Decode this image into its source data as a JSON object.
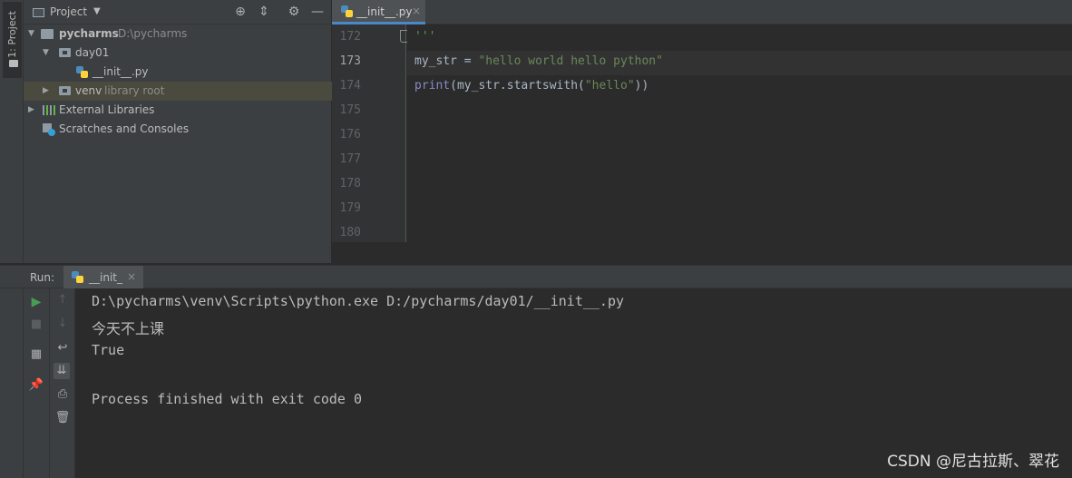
{
  "tool_strip": {
    "project_tab": "1: Project"
  },
  "project_pane": {
    "title": "Project",
    "tree": [
      {
        "label": "pycharms",
        "hint": "D:\\pycharms"
      },
      {
        "label": "day01"
      },
      {
        "label": "__init__.py"
      },
      {
        "label": "venv",
        "hint": "library root"
      },
      {
        "label": "External Libraries"
      },
      {
        "label": "Scratches and Consoles"
      }
    ]
  },
  "editor": {
    "tab_label": "__init__.py",
    "line_numbers": [
      "172",
      "173",
      "174",
      "175",
      "176",
      "177",
      "178",
      "179",
      "180"
    ],
    "lines": {
      "l172": "'''",
      "l173_var": "my_str = ",
      "l173_str": "\"hello world hello python\"",
      "l174_fn": "print",
      "l174_mid": "(my_str.startswith(",
      "l174_str": "\"hello\"",
      "l174_end": "))"
    }
  },
  "run": {
    "label": "Run:",
    "tab_label": "__init_",
    "console": [
      "D:\\pycharms\\venv\\Scripts\\python.exe D:/pycharms/day01/__init__.py",
      "今天不上课",
      "True",
      "",
      "Process finished with exit code 0"
    ]
  },
  "watermark": "CSDN @尼古拉斯、翠花",
  "colors": {
    "accent": "#4a88c7",
    "string": "#6a8759",
    "builtin": "#8888c6",
    "run_green": "#499c54"
  }
}
